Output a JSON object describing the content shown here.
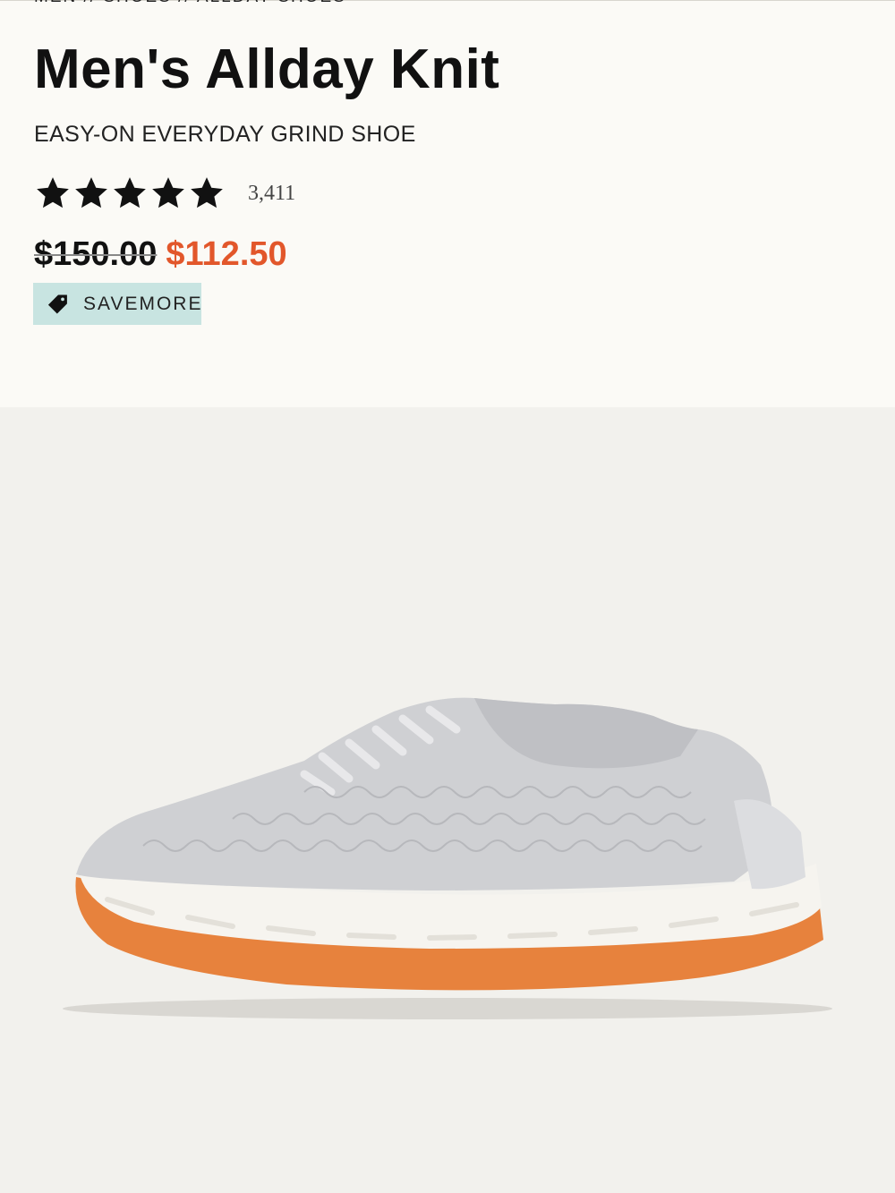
{
  "breadcrumb": "MEN // SHOES // ALLDAY SHOES",
  "product": {
    "title": "Men's Allday Knit",
    "subtitle": "EASY-ON EVERYDAY GRIND SHOE",
    "rating": 5,
    "rating_max": 5,
    "review_count": "3,411",
    "price_original": "$150.00",
    "price_sale": "$112.50",
    "promo_label": "SAVEMORE"
  },
  "colors": {
    "sale": "#e2572b",
    "promo_bg": "#c8e4e1",
    "page_bg": "#fbfaf6",
    "image_bg": "#f2f1ed"
  },
  "icons": {
    "star": "star-icon",
    "promo": "price-tag-icon"
  },
  "image": {
    "subject": "light grey knit sneaker with white midsole and gum sole"
  }
}
